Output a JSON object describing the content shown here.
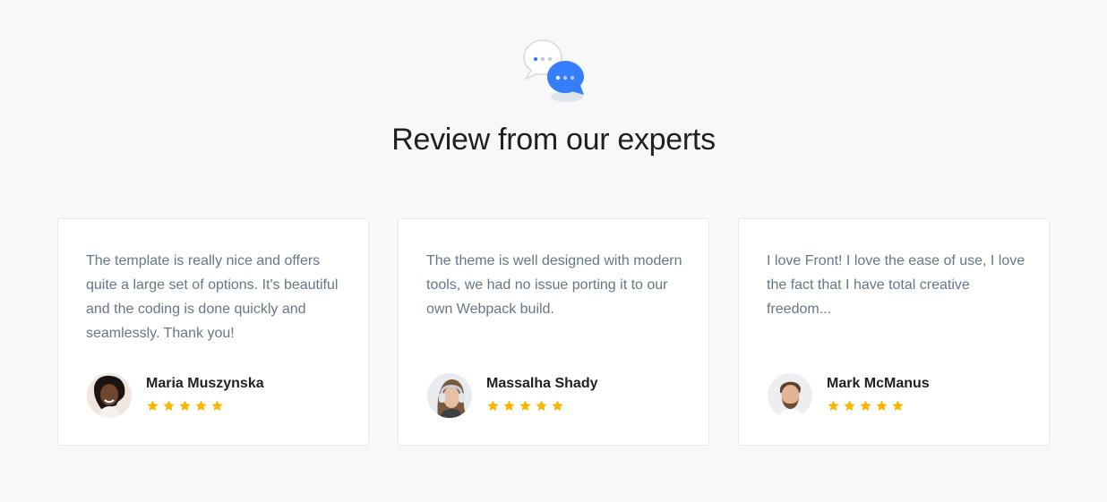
{
  "section": {
    "icon": "chat-bubbles-icon",
    "title": "Review from our experts"
  },
  "colors": {
    "accent": "#377dff",
    "star": "#fdb300",
    "background": "#f7f8fa"
  },
  "reviews": [
    {
      "quote": "The template is really nice and offers quite a large set of options. It's beautiful and the coding is done quickly and seamlessly. Thank you!",
      "name": "Maria Muszynska",
      "rating": 5
    },
    {
      "quote": "The theme is well designed with modern tools, we had no issue porting it to our own Webpack build.",
      "name": "Massalha Shady",
      "rating": 5
    },
    {
      "quote": "I love Front! I love the ease of use, I love the fact that I have total creative freedom...",
      "name": "Mark McManus",
      "rating": 5
    }
  ]
}
